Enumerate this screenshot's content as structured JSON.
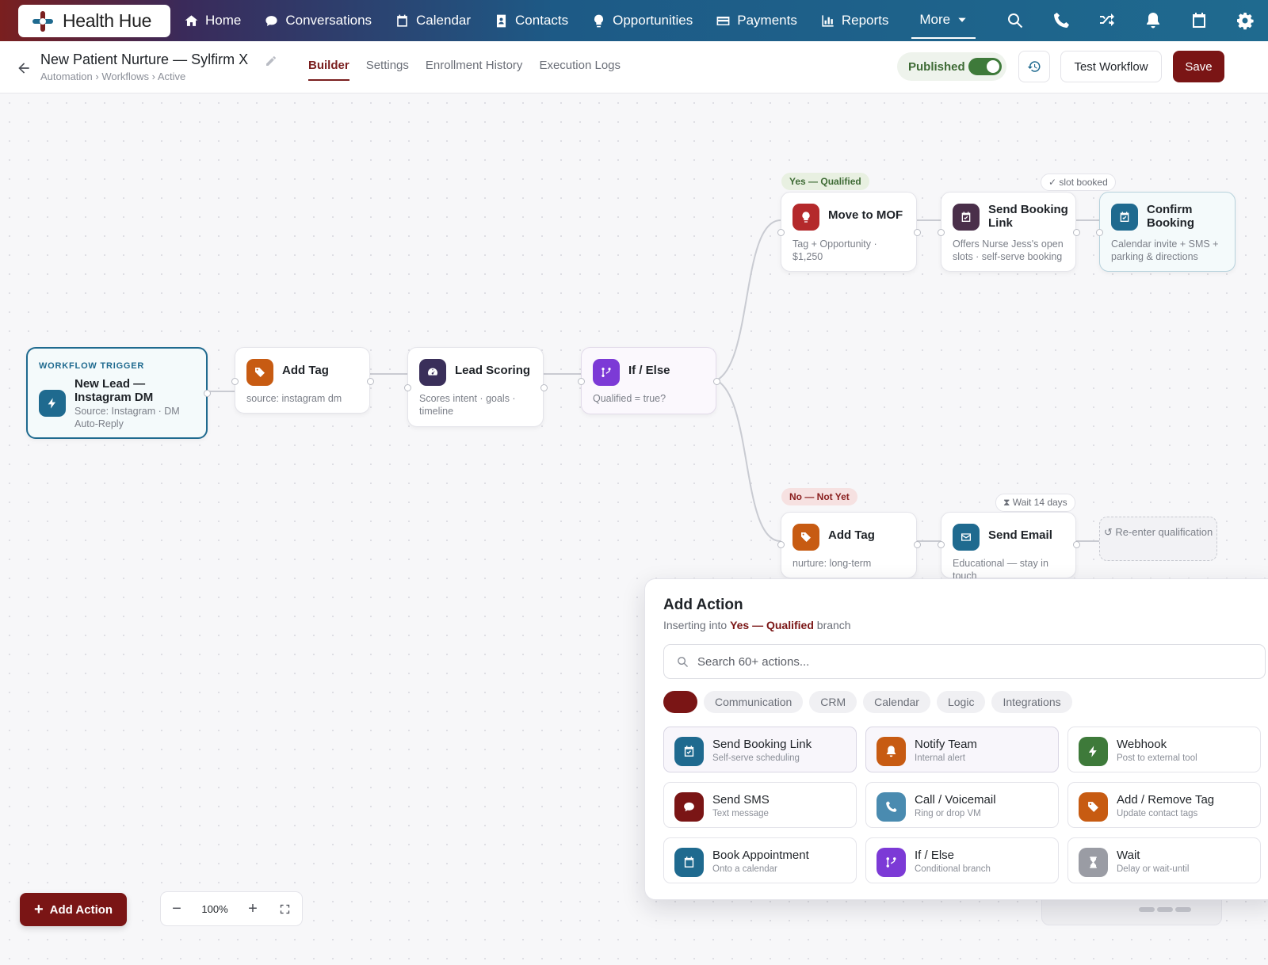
{
  "app": {
    "name": "Health Hue"
  },
  "nav": {
    "items": [
      {
        "label": "Home",
        "icon": "home-icon"
      },
      {
        "label": "Conversations",
        "icon": "chat-bubble-icon"
      },
      {
        "label": "Calendar",
        "icon": "calendar-icon"
      },
      {
        "label": "Contacts",
        "icon": "contact-card-icon"
      },
      {
        "label": "Opportunities",
        "icon": "lightbulb-icon"
      },
      {
        "label": "Payments",
        "icon": "credit-card-icon"
      },
      {
        "label": "Reports",
        "icon": "bar-chart-icon"
      }
    ],
    "more_label": "More",
    "right_icons": [
      "search-icon",
      "phone-icon",
      "shuffle-icon",
      "bell-icon",
      "calendar-icon",
      "gear-icon"
    ]
  },
  "header": {
    "title": "New Patient Nurture — Sylfirm X",
    "breadcrumb": "Automation › Workflows › Active",
    "tabs": [
      "Builder",
      "Settings",
      "Enrollment History",
      "Execution Logs"
    ],
    "active_tab": "Builder",
    "status_label": "Published",
    "test_label": "Test Workflow",
    "save_label": "Save"
  },
  "colors": {
    "brand": "#7a1515",
    "nav_gradient_end": "#1f6a8f",
    "published_green": "#3e7a3a",
    "tag_orange": "#c75b12",
    "ifelse_purple": "#7c3ad6"
  },
  "workflow": {
    "trigger": {
      "label": "WORKFLOW TRIGGER",
      "title": "New Lead — Instagram DM",
      "subtitle": "Source: Instagram · DM Auto-Reply",
      "icon": "lightning-icon"
    },
    "nodes": {
      "add_tag_1": {
        "title": "Add Tag",
        "subtitle": "source: instagram dm",
        "icon": "tag-icon"
      },
      "lead_scoring": {
        "title": "Lead Scoring",
        "subtitle": "Scores intent · goals · timeline",
        "icon": "gauge-icon"
      },
      "if_else": {
        "title": "If / Else",
        "subtitle": "Qualified = true?",
        "icon": "branch-icon"
      },
      "move_mof": {
        "title": "Move to MOF",
        "subtitle": "Tag + Opportunity · $1,250",
        "icon": "lightbulb-icon"
      },
      "send_booking": {
        "title": "Send Booking Link",
        "subtitle": "Offers Nurse Jess's open slots · self-serve booking",
        "icon": "calendar-check-icon"
      },
      "confirm_booking": {
        "title": "Confirm Booking",
        "subtitle": "Calendar invite + SMS + parking & directions",
        "icon": "calendar-check-icon"
      },
      "add_tag_2": {
        "title": "Add Tag",
        "subtitle": "nurture: long-term",
        "icon": "tag-icon"
      },
      "send_email": {
        "title": "Send Email",
        "subtitle": "Educational — stay in touch",
        "icon": "envelope-icon"
      }
    },
    "branch_yes": "Yes — Qualified",
    "branch_no": "No — Not Yet",
    "hint_slot": "slot booked",
    "hint_wait": "Wait 14 days",
    "reenter": "Re-enter qualification"
  },
  "panel": {
    "title": "Add Action",
    "subtitle_prefix": "Inserting into",
    "subtitle_branch": "Yes — Qualified",
    "subtitle_suffix": "branch",
    "search_placeholder": "Search 60+ actions...",
    "filters": [
      "Communication",
      "CRM",
      "Calendar",
      "Logic",
      "Integrations"
    ],
    "actions": [
      {
        "name": "Send Booking Link",
        "desc": "Self-serve scheduling",
        "icon": "calendar-check-icon",
        "color": "#1f6a8f"
      },
      {
        "name": "Notify Team",
        "desc": "Internal alert",
        "icon": "bell-icon",
        "color": "#c75b12"
      },
      {
        "name": "Webhook",
        "desc": "Post to external tool",
        "icon": "lightning-icon",
        "color": "#3e7a3a"
      },
      {
        "name": "Send SMS",
        "desc": "Text message",
        "icon": "chat-bubble-icon",
        "color": "#7a1515"
      },
      {
        "name": "Call / Voicemail",
        "desc": "Ring or drop VM",
        "icon": "phone-icon",
        "color": "#4a8bb0"
      },
      {
        "name": "Add / Remove Tag",
        "desc": "Update contact tags",
        "icon": "tag-icon",
        "color": "#c75b12"
      },
      {
        "name": "Book Appointment",
        "desc": "Onto a calendar",
        "icon": "calendar-icon",
        "color": "#1f6a8f"
      },
      {
        "name": "If / Else",
        "desc": "Conditional branch",
        "icon": "branch-icon",
        "color": "#7c3ad6"
      },
      {
        "name": "Wait",
        "desc": "Delay or wait-until",
        "icon": "hourglass-icon",
        "color": "#9a9ca4"
      }
    ]
  },
  "toolbar": {
    "add_action_label": "Add Action",
    "zoom_level": "100%"
  }
}
